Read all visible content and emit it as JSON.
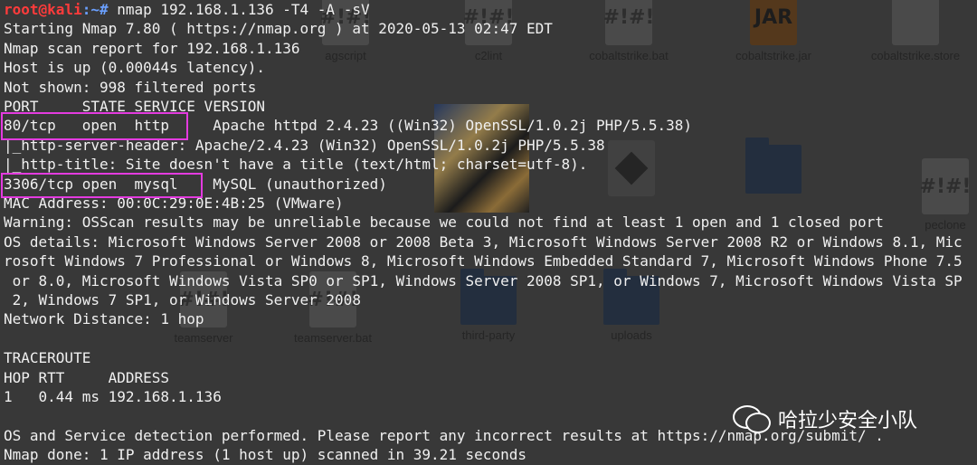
{
  "desktop": {
    "files": [
      {
        "name": "agscript",
        "icon": "script-file-icon"
      },
      {
        "name": "c2lint",
        "icon": "script-file-icon"
      },
      {
        "name": "cobaltstrike.bat",
        "icon": "script-file-icon"
      },
      {
        "name": "cobaltstrike.jar",
        "icon": "jar-file-icon"
      },
      {
        "name": "cobaltstrike.store",
        "icon": "document-file-icon"
      },
      {
        "name": "peclone",
        "icon": "script-file-icon"
      },
      {
        "name": "teamserver",
        "icon": "script-file-icon"
      },
      {
        "name": "teamserver.bat",
        "icon": "script-file-icon"
      },
      {
        "name": "third-party",
        "icon": "folder-icon"
      },
      {
        "name": "uploads",
        "icon": "folder-icon"
      }
    ],
    "jar_label": "JAR",
    "script_glyph": "#!"
  },
  "terminal": {
    "prompt_user": "root@kali",
    "prompt_path": ":~#",
    "command": " nmap 192.168.1.136 -T4 -A -sV",
    "lines": [
      "Starting Nmap 7.80 ( https://nmap.org ) at 2020-05-13 02:47 EDT",
      "Nmap scan report for 192.168.1.136",
      "Host is up (0.00044s latency).",
      "Not shown: 998 filtered ports",
      "PORT     STATE SERVICE VERSION",
      "80/tcp   open  http     Apache httpd 2.4.23 ((Win32) OpenSSL/1.0.2j PHP/5.5.38)",
      "|_http-server-header: Apache/2.4.23 (Win32) OpenSSL/1.0.2j PHP/5.5.38",
      "|_http-title: Site doesn't have a title (text/html; charset=utf-8).",
      "3306/tcp open  mysql    MySQL (unauthorized)",
      "MAC Address: 00:0C:29:0E:4B:25 (VMware)",
      "Warning: OSScan results may be unreliable because we could not find at least 1 open and 1 closed port",
      "OS details: Microsoft Windows Server 2008 or 2008 Beta 3, Microsoft Windows Server 2008 R2 or Windows 8.1, Mic",
      "rosoft Windows 7 Professional or Windows 8, Microsoft Windows Embedded Standard 7, Microsoft Windows Phone 7.5",
      " or 8.0, Microsoft Windows Vista SP0 or SP1, Windows Server 2008 SP1, or Windows 7, Microsoft Windows Vista SP",
      " 2, Windows 7 SP1, or Windows Server 2008",
      "Network Distance: 1 hop",
      "",
      "TRACEROUTE",
      "HOP RTT     ADDRESS",
      "1   0.44 ms 192.168.1.136",
      "",
      "OS and Service detection performed. Please report any incorrect results at https://nmap.org/submit/ .",
      "Nmap done: 1 IP address (1 host up) scanned in 39.21 seconds"
    ]
  },
  "watermark": {
    "text": "哈拉少安全小队"
  },
  "colors": {
    "highlight": "#e43be0",
    "prompt_user": "#ff3b3b",
    "prompt_path": "#6aa0ff"
  }
}
